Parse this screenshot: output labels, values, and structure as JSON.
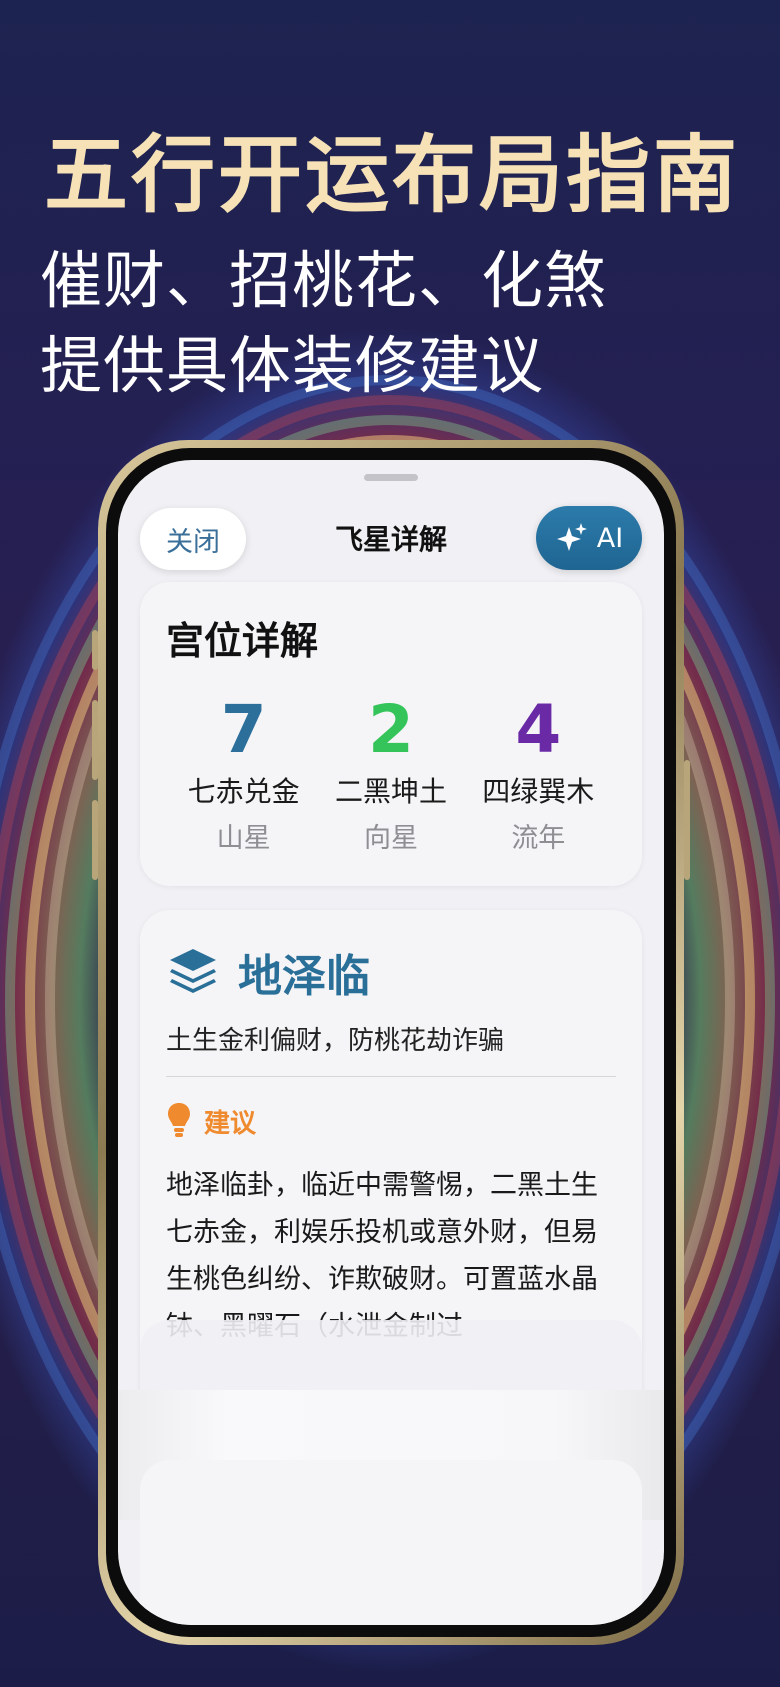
{
  "banner": {
    "headline": "五行开运布局指南",
    "subline_1": "催财、招桃花、化煞",
    "subline_2": "提供具体装修建议"
  },
  "sheet": {
    "close_label": "关闭",
    "title": "飞星详解",
    "ai_label": "AI"
  },
  "palace": {
    "heading": "宫位详解",
    "stars": [
      {
        "number": "7",
        "name": "七赤兑金",
        "role": "山星",
        "color": "#2b6f9a"
      },
      {
        "number": "2",
        "name": "二黑坤土",
        "role": "向星",
        "color": "#35c45a"
      },
      {
        "number": "4",
        "name": "四绿巽木",
        "role": "流年",
        "color": "#6a2aa6"
      }
    ]
  },
  "hexagram": {
    "name": "地泽临",
    "summary": "土生金利偏财，防桃花劫诈骗",
    "tip_label": "建议",
    "advice": "地泽临卦，临近中需警惕，二黑土生七赤金，利娱乐投机或意外财，但易生桃色纠纷、诈欺破财。可置蓝水晶钵、黑曜石（水泄金制过"
  },
  "colors": {
    "headline": "#f6e2b6",
    "accent_blue": "#2a6f98",
    "tip_orange": "#ef8a2e"
  },
  "icons": {
    "sparkle": "sparkles-icon",
    "layers": "layers-icon",
    "bulb": "lightbulb-icon"
  }
}
